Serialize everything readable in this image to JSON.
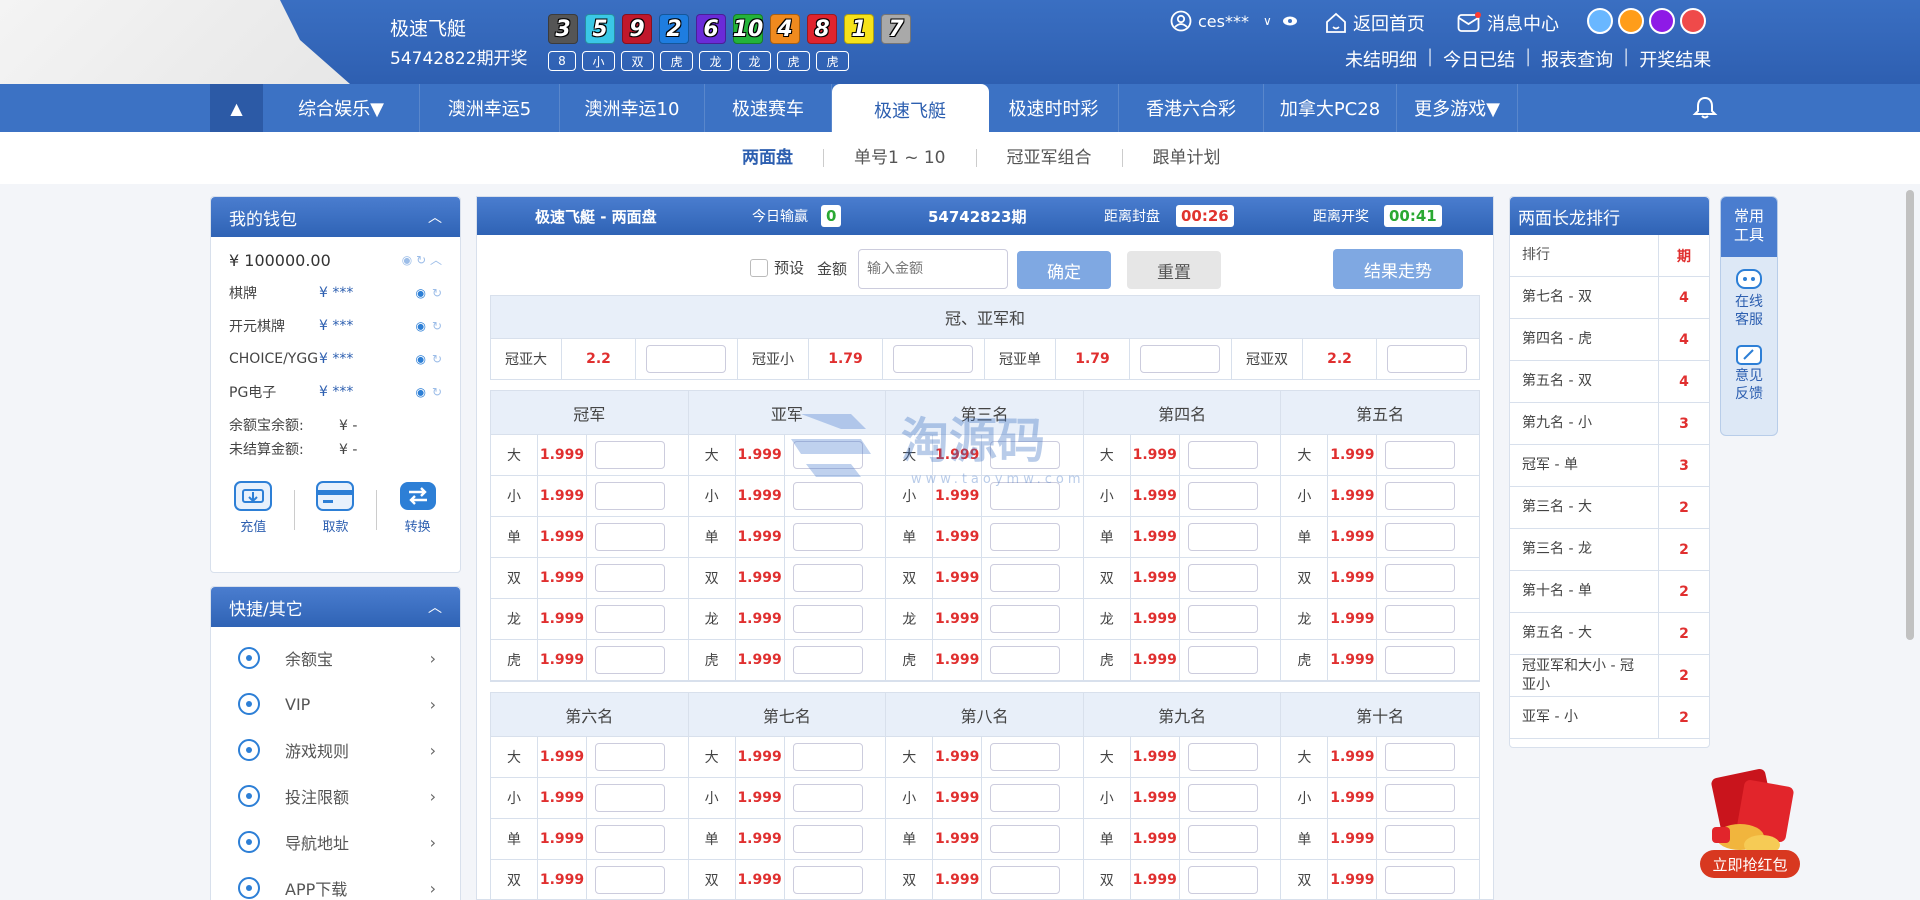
{
  "header": {
    "lottery_name": "极速飞艇",
    "period_text": "54742822期开奖",
    "balls": [
      {
        "n": "3",
        "color": "#555555"
      },
      {
        "n": "5",
        "color": "#3ac8e6"
      },
      {
        "n": "9",
        "color": "#c0182b"
      },
      {
        "n": "2",
        "color": "#1e7de0"
      },
      {
        "n": "6",
        "color": "#6a2bd8"
      },
      {
        "n": "10",
        "color": "#23b33a"
      },
      {
        "n": "4",
        "color": "#f08a1e"
      },
      {
        "n": "8",
        "color": "#e0242e"
      },
      {
        "n": "1",
        "color": "#f6e21a"
      },
      {
        "n": "7",
        "color": "#a9a9a9"
      }
    ],
    "tags": [
      "8",
      "小",
      "双",
      "虎",
      "龙",
      "龙",
      "虎",
      "虎"
    ],
    "user": "ces***",
    "home_label": "返回首页",
    "msg_label": "消息中心",
    "links": [
      "未结明细",
      "今日已结",
      "报表查询",
      "开奖结果"
    ],
    "skins": [
      "#69b7ff",
      "#ff9d1a",
      "#8e1ae6",
      "#ef4a4a"
    ]
  },
  "nav": {
    "items": [
      "综合娱乐▼",
      "澳洲幸运5",
      "澳洲幸运10",
      "极速赛车",
      "极速飞艇",
      "极速时时彩",
      "香港六合彩",
      "加拿大PC28",
      "更多游戏▼"
    ],
    "active_index": 4
  },
  "subnav": {
    "items": [
      "两面盘",
      "单号1 ~ 10",
      "冠亚军组合",
      "跟单计划"
    ],
    "active_index": 0
  },
  "wallet": {
    "title": "我的钱包",
    "balance": "¥ 100000.00",
    "rows": [
      {
        "name": "棋牌",
        "value": "¥ ***"
      },
      {
        "name": "开元棋牌",
        "value": "¥ ***"
      },
      {
        "name": "CHOICE/YGG",
        "value": "¥ ***"
      },
      {
        "name": "PG电子",
        "value": "¥ ***"
      }
    ],
    "yeb_label": "余额宝余额:",
    "yeb_value": "¥ -",
    "unsettled_label": "未结算金额:",
    "unsettled_value": "¥ -",
    "actions": [
      "充值",
      "取款",
      "转换"
    ]
  },
  "quick": {
    "title": "快捷/其它",
    "items": [
      "余额宝",
      "VIP",
      "游戏规则",
      "投注限额",
      "导航地址",
      "APP下载"
    ]
  },
  "bet": {
    "title": "极速飞艇 - 两面盘",
    "today_label": "今日输赢",
    "today_value": "0",
    "period": "54742823期",
    "close_label": "距离封盘",
    "close_time": "00:26",
    "draw_label": "距离开奖",
    "draw_time": "00:41",
    "preset_label": "预设",
    "amount_label": "金额",
    "amount_placeholder": "输入金额",
    "confirm": "确定",
    "reset": "重置",
    "trend": "结果走势",
    "sum_title": "冠、亚军和",
    "sum": [
      {
        "label": "冠亚大",
        "odds": "2.2"
      },
      {
        "label": "冠亚小",
        "odds": "1.79"
      },
      {
        "label": "冠亚单",
        "odds": "1.79"
      },
      {
        "label": "冠亚双",
        "odds": "2.2"
      }
    ],
    "group1": [
      "冠军",
      "亚军",
      "第三名",
      "第四名",
      "第五名"
    ],
    "group2": [
      "第六名",
      "第七名",
      "第八名",
      "第九名",
      "第十名"
    ],
    "bets": [
      "大",
      "小",
      "单",
      "双",
      "龙",
      "虎"
    ],
    "group2_bets": [
      "大",
      "小",
      "单",
      "双"
    ],
    "odds": "1.999"
  },
  "rank": {
    "title": "两面长龙排行",
    "head_name": "排行",
    "head_count": "期",
    "rows": [
      {
        "name": "第七名 - 双",
        "count": "4"
      },
      {
        "name": "第四名 - 虎",
        "count": "4"
      },
      {
        "name": "第五名 - 双",
        "count": "4"
      },
      {
        "name": "第九名 - 小",
        "count": "3"
      },
      {
        "name": "冠军 - 单",
        "count": "3"
      },
      {
        "name": "第三名 - 大",
        "count": "2"
      },
      {
        "name": "第三名 - 龙",
        "count": "2"
      },
      {
        "name": "第十名 - 单",
        "count": "2"
      },
      {
        "name": "第五名 - 大",
        "count": "2"
      },
      {
        "name": "冠亚军和大小 - 冠亚小",
        "count": "2"
      },
      {
        "name": "亚军 - 小",
        "count": "2"
      }
    ]
  },
  "tools": {
    "title": "常用工具",
    "service": "在线客服",
    "feedback": "意见反馈"
  },
  "redpacket": "立即抢红包",
  "watermark": {
    "text": "淘源码",
    "url": "www.taoymw.com"
  }
}
